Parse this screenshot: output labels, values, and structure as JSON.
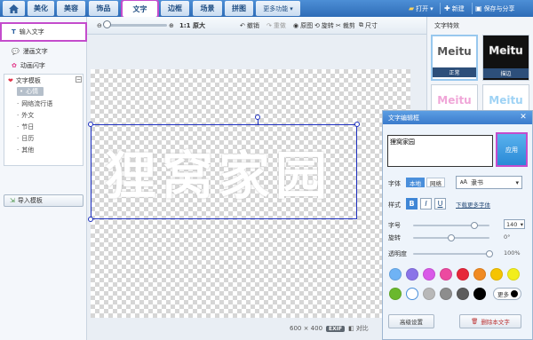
{
  "nav": {
    "tabs": [
      "美化",
      "美容",
      "饰品",
      "文字",
      "边框",
      "场景",
      "拼图"
    ],
    "more": "更多功能",
    "open": "打开",
    "new": "新建",
    "save": "保存与分享"
  },
  "toolbar": {
    "zoom_original": "1:1 原大",
    "undo": "撤销",
    "redo": "重做",
    "original": "原图",
    "rotate": "旋转",
    "crop": "裁剪",
    "resize": "尺寸"
  },
  "sidebar": {
    "input_text": "输入文字",
    "comic_text": "漫画文字",
    "flash_text": "动画闪字",
    "template_title": "文字模板",
    "templates": [
      "心情",
      "网络流行语",
      "外文",
      "节日",
      "日历",
      "其他"
    ],
    "import": "导入模板"
  },
  "canvas": {
    "text": "狸窝家园",
    "size": "600 × 400",
    "exif": "EXIF",
    "compare": "对比"
  },
  "effects": {
    "title": "文字特效",
    "cards": [
      {
        "word": "Meitu",
        "label": "正常"
      },
      {
        "word": "Meitu",
        "label": "描边"
      },
      {
        "word": "Meitu",
        "label": ""
      },
      {
        "word": "Meitu",
        "label": ""
      }
    ]
  },
  "editor": {
    "title": "文字编辑框",
    "text_value": "狸窝家园",
    "apply": "应用",
    "font_label": "字体",
    "font_local": "本地",
    "font_online": "网络",
    "font_name": "隶书",
    "style_label": "样式",
    "bold": "B",
    "italic": "I",
    "underline": "U",
    "more_fonts": "下载更多字体",
    "size_label": "字号",
    "size_value": "140",
    "rotate_label": "旋转",
    "rotate_value": "0°",
    "opacity_label": "透明度",
    "opacity_value": "100%",
    "size_level": 0.8,
    "rotate_level": 0.5,
    "opacity_level": 1.0,
    "colors": [
      "#6fb3f5",
      "#8a74e8",
      "#d95ae8",
      "#ec4aa0",
      "#e6273a",
      "#f08a22",
      "#f5c400",
      "#f2ee1c",
      "#6ab82d",
      "#ffffff",
      "#b8b8b8",
      "#8d8d8d",
      "#5c5c5c",
      "#000000"
    ],
    "more_colors": "更多",
    "advanced": "高级设置",
    "delete": "删除本文字"
  }
}
